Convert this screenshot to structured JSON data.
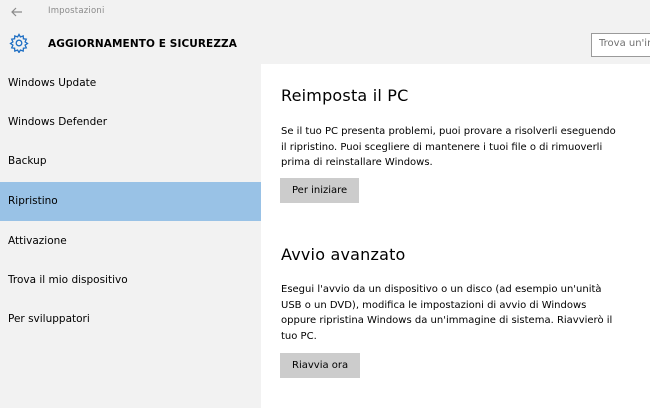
{
  "window": {
    "app_title": "Impostazioni"
  },
  "header": {
    "section_title": "AGGIORNAMENTO E SICUREZZA",
    "search_text": "Trova un'impostazione"
  },
  "sidebar": {
    "items": [
      {
        "label": "Windows Update",
        "selected": false
      },
      {
        "label": "Windows Defender",
        "selected": false
      },
      {
        "label": "Backup",
        "selected": false
      },
      {
        "label": "Ripristino",
        "selected": true
      },
      {
        "label": "Attivazione",
        "selected": false
      },
      {
        "label": "Trova il mio dispositivo",
        "selected": false
      },
      {
        "label": "Per sviluppatori",
        "selected": false
      }
    ]
  },
  "main": {
    "reset": {
      "heading": "Reimposta il PC",
      "line1": "Se il tuo PC presenta problemi, puoi provare a risolverli eseguendo",
      "line2": "il ripristino. Puoi scegliere di mantenere i tuoi file o di rimuoverli",
      "line3": "prima di reinstallare Windows.",
      "button": "Per iniziare"
    },
    "advanced": {
      "heading": "Avvio avanzato",
      "line1": "Esegui l'avvio da un dispositivo o un disco (ad esempio un'unità",
      "line2": "USB o un DVD), modifica le impostazioni di avvio di Windows",
      "line3": "oppure ripristina Windows da un'immagine di sistema. Riavvierò il",
      "line4": "tuo PC.",
      "button": "Riavvia ora"
    }
  },
  "colors": {
    "accent": "#99c2e6",
    "chrome": "#f2f2f2",
    "button": "#cccccc",
    "gear_icon": "#1f6fc4"
  },
  "icons": {
    "back": "back-arrow-icon",
    "settings": "gear-icon"
  }
}
